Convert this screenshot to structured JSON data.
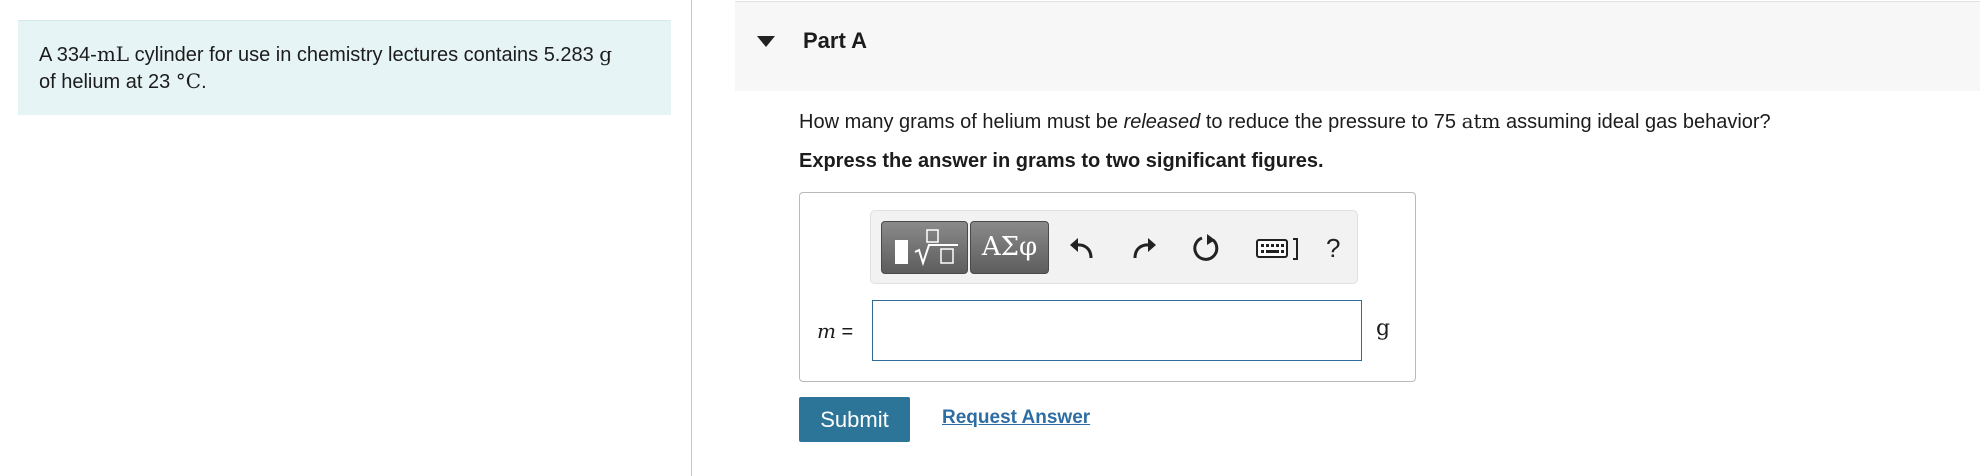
{
  "problem": {
    "text_1": "A 334-",
    "volume_unit": "mL",
    "text_2": " cylinder for use in chemistry lectures contains 5.283 ",
    "mass_unit": "g",
    "text_3": "of helium at 23 ",
    "temp_unit": "°C",
    "text_4": "."
  },
  "part": {
    "title": "Part A"
  },
  "question": {
    "text_1": "How many grams of helium must be ",
    "emphasis": "released",
    "text_2": " to reduce the pressure to 75 ",
    "pressure_unit": "atm",
    "text_3": " assuming ideal gas behavior?",
    "instruction": "Express the answer in grams to two significant figures."
  },
  "toolbar": {
    "greek_label": "ΑΣφ",
    "help_label": "?",
    "icons": [
      "templates-icon",
      "greek-letters-icon",
      "undo-icon",
      "redo-icon",
      "reset-icon",
      "keyboard-icon",
      "help-icon"
    ]
  },
  "answer": {
    "variable": "m",
    "equals": " =",
    "value": "",
    "unit": "g"
  },
  "actions": {
    "submit_label": "Submit",
    "request_label": "Request Answer"
  },
  "colors": {
    "problem_bg": "#e6f4f5",
    "accent": "#2d7598",
    "link": "#2d6da3",
    "input_border": "#2e6c99"
  }
}
